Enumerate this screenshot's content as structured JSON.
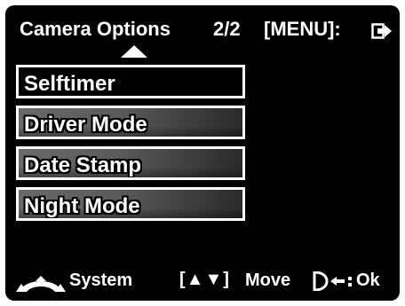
{
  "header": {
    "title": "Camera Options",
    "page": "2/2",
    "menu_key": "[MENU]:",
    "exit_icon": "exit-icon",
    "scroll_up_icon": "up-arrow-icon"
  },
  "menu": {
    "items": [
      {
        "label": "Selftimer",
        "selected": true
      },
      {
        "label": "Driver Mode",
        "selected": false
      },
      {
        "label": "Date Stamp",
        "selected": false
      },
      {
        "label": "Night Mode",
        "selected": false
      }
    ]
  },
  "footer": {
    "system_icon": "mode-dial-icon",
    "system_label": "System",
    "move_icon_text": "[▲▼]",
    "move_label": "Move",
    "ok_icon": "shutter-enter-icon",
    "ok_label": "Ok"
  },
  "colors": {
    "background": "#000000",
    "text": "#ffffff",
    "item_border": "#ffffff",
    "item_fill": "#5a5a5a"
  }
}
